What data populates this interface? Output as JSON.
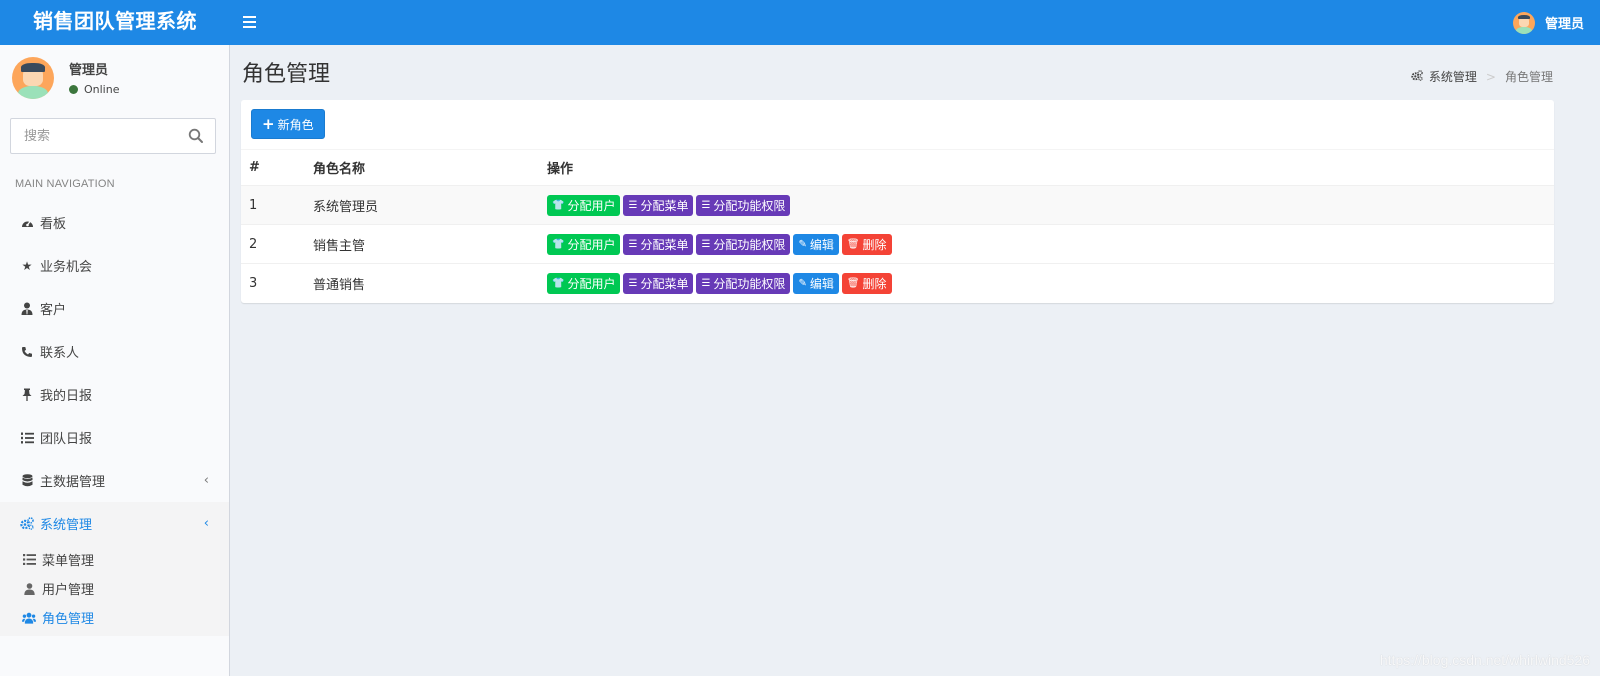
{
  "header": {
    "logo": "销售团队管理系统",
    "menu_icon": "hamburger-icon",
    "user_name": "管理员",
    "brand_color": "#1e88e5"
  },
  "sidebar": {
    "user": {
      "name": "管理员",
      "status": "Online"
    },
    "search": {
      "placeholder": "搜索",
      "icon": "search-icon"
    },
    "nav_header": "MAIN NAVIGATION",
    "items": [
      {
        "label": "看板",
        "icon": "dashboard-icon"
      },
      {
        "label": "业务机会",
        "icon": "star-icon"
      },
      {
        "label": "客户",
        "icon": "user-tie-icon"
      },
      {
        "label": "联系人",
        "icon": "phone-icon"
      },
      {
        "label": "我的日报",
        "icon": "pin-icon"
      },
      {
        "label": "团队日报",
        "icon": "list-ol-icon"
      },
      {
        "label": "主数据管理",
        "icon": "database-icon",
        "chevron": "‹"
      },
      {
        "label": "系统管理",
        "icon": "cogs-icon",
        "chevron": "‹",
        "active": true
      }
    ],
    "subitems": [
      {
        "label": "菜单管理",
        "icon": "list-icon"
      },
      {
        "label": "用户管理",
        "icon": "user-icon"
      },
      {
        "label": "角色管理",
        "icon": "users-icon",
        "active": true
      }
    ]
  },
  "main": {
    "title": "角色管理",
    "breadcrumb": {
      "parent": "系统管理",
      "current": "角色管理",
      "separator": ">"
    },
    "new_button": "新角色",
    "table": {
      "headers": [
        "#",
        "角色名称",
        "操作"
      ],
      "rows": [
        {
          "id": "1",
          "name": "系统管理员"
        },
        {
          "id": "2",
          "name": "销售主管"
        },
        {
          "id": "3",
          "name": "普通销售"
        }
      ]
    },
    "actions": {
      "assign_user": "分配用户",
      "assign_menu": "分配菜单",
      "assign_permission": "分配功能权限",
      "edit": "编辑",
      "delete": "删除"
    },
    "colors": {
      "green": "#00c853",
      "purple": "#673ab7",
      "blue": "#1e88e5",
      "red": "#f44336"
    }
  },
  "watermark": "https://blog.csdn.net/whirlwind526"
}
